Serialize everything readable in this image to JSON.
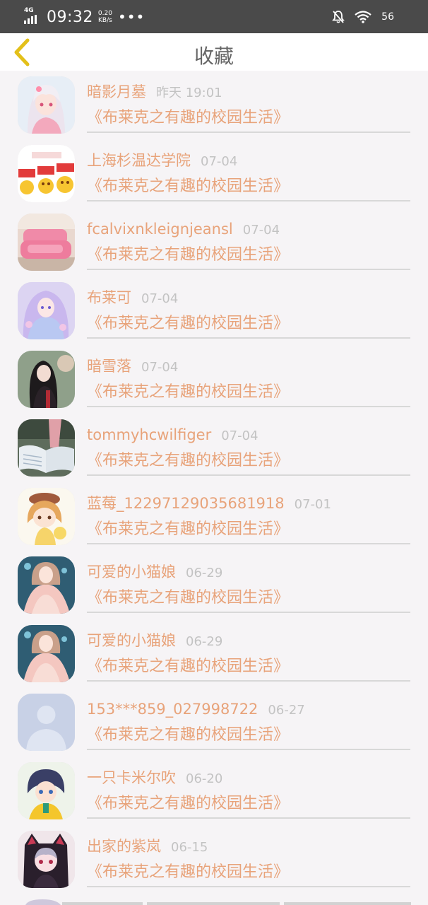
{
  "status_bar": {
    "network": "4G",
    "time": "09:32",
    "speed_value": "0.20",
    "speed_unit": "KB/s",
    "more": "•••",
    "battery": "56"
  },
  "header": {
    "title": "收藏"
  },
  "colors": {
    "accent": "#e8a37a",
    "back_arrow": "#e3c01a",
    "date": "#c3c3c3",
    "status_bg": "#4a4a4a"
  },
  "items": [
    {
      "name": "暗影月墓",
      "date": "昨天 19:01",
      "book": "《布莱克之有趣的校园生活》",
      "avatar_icon": "anime-girl-pink"
    },
    {
      "name": "上海杉温达学院",
      "date": "07-04",
      "book": "《布莱克之有趣的校园生活》",
      "avatar_icon": "okay-emoji-sticker"
    },
    {
      "name": "fcalvixnkleignjeansl",
      "date": "07-04",
      "book": "《布莱克之有趣的校园生活》",
      "avatar_icon": "pink-sofa"
    },
    {
      "name": "布莱可",
      "date": "07-04",
      "book": "《布莱克之有趣的校园生活》",
      "avatar_icon": "anime-girl-lavender"
    },
    {
      "name": "暗雪落",
      "date": "07-04",
      "book": "《布莱克之有趣的校园生活》",
      "avatar_icon": "dark-hair-girl"
    },
    {
      "name": "tommyhcwilfiger",
      "date": "07-04",
      "book": "《布莱克之有趣的校园生活》",
      "avatar_icon": "open-book"
    },
    {
      "name": "蓝莓_1229712903568191​8",
      "date": "07-01",
      "book": "《布莱克之有趣的校园生活》",
      "avatar_icon": "chibi-girl-beret"
    },
    {
      "name": "可爱的小猫娘",
      "date": "06-29",
      "book": "《布莱克之有趣的校园生活》",
      "avatar_icon": "anime-girl-teal"
    },
    {
      "name": "可爱的小猫娘",
      "date": "06-29",
      "book": "《布莱克之有趣的校园生活》",
      "avatar_icon": "anime-girl-teal"
    },
    {
      "name": "153***859_027998722",
      "date": "06-27",
      "book": "《布莱克之有趣的校园生活》",
      "avatar_icon": "default-user"
    },
    {
      "name": "一只卡米尔吹",
      "date": "06-20",
      "book": "《布莱克之有趣的校园生活》",
      "avatar_icon": "anime-boy-yellow"
    },
    {
      "name": "出家的紫岚",
      "date": "06-15",
      "book": "《布莱克之有趣的校园生活》",
      "avatar_icon": "anime-girl-cat-hood"
    }
  ]
}
